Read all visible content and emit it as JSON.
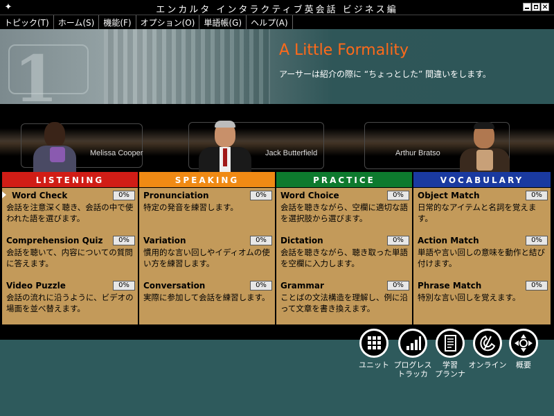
{
  "window": {
    "title": "エンカルタ インタラクティブ英会話 ビジネス編",
    "controls": [
      "minimize",
      "maximize",
      "close"
    ]
  },
  "menu": [
    "トピック(T)",
    "ホーム(S)",
    "機能(F)",
    "オプション(O)",
    "単語帳(G)",
    "ヘルプ(A)"
  ],
  "lesson": {
    "number": "1",
    "title": "A Little Formality",
    "description": "アーサーは紹介の際に “ちょっとした” 間違いをします。"
  },
  "characters": [
    {
      "name": "Melissa Cooper"
    },
    {
      "name": "Jack Butterfield"
    },
    {
      "name": "Arthur Bratso"
    }
  ],
  "colors": {
    "listening": "#d11d16",
    "speaking": "#f08a14",
    "practice": "#0d7a2e",
    "vocabulary": "#1a3aa0",
    "panel_bg": "#c39a5a",
    "title_orange": "#ff6a1a",
    "teal": "#2e5a5c"
  },
  "sections": [
    {
      "heading": "LISTENING",
      "activities": [
        {
          "title": "Word Check",
          "progress": "0%",
          "desc": "会話を注意深く聴き、会話の中で使われた語を選びます。",
          "selected": true
        },
        {
          "title": "Comprehension Quiz",
          "progress": "0%",
          "desc": "会話を聴いて、内容についての質問に答えます。"
        },
        {
          "title": "Video Puzzle",
          "progress": "0%",
          "desc": "会話の流れに沿うように、ビデオの場面を並べ替えます。"
        }
      ]
    },
    {
      "heading": "SPEAKING",
      "activities": [
        {
          "title": "Pronunciation",
          "progress": "0%",
          "desc": "特定の発音を練習します。"
        },
        {
          "title": "Variation",
          "progress": "0%",
          "desc": "慣用的な言い回しやイディオムの使い方を練習します。"
        },
        {
          "title": "Conversation",
          "progress": "0%",
          "desc": "実際に参加して会話を練習します。"
        }
      ]
    },
    {
      "heading": "PRACTICE",
      "activities": [
        {
          "title": "Word Choice",
          "progress": "0%",
          "desc": "会話を聴きながら、空欄に適切な語を選択肢から選びます。"
        },
        {
          "title": "Dictation",
          "progress": "0%",
          "desc": "会話を聴きながら、聴き取った単語を空欄に入力します。"
        },
        {
          "title": "Grammar",
          "progress": "0%",
          "desc": "ことばの文法構造を理解し、例に沿って文章を書き換えます。"
        }
      ]
    },
    {
      "heading": "VOCABULARY",
      "activities": [
        {
          "title": "Object Match",
          "progress": "0%",
          "desc": "日常的なアイテムと名詞を覚えます。"
        },
        {
          "title": "Action Match",
          "progress": "0%",
          "desc": "単語や言い回しの意味を動作と結び付けます。"
        },
        {
          "title": "Phrase Match",
          "progress": "0%",
          "desc": "特別な言い回しを覚えます。"
        }
      ]
    }
  ],
  "nav": [
    {
      "icon": "grid-icon",
      "label_line1": "ユニット",
      "label_line2": ""
    },
    {
      "icon": "bar-chart-icon",
      "label_line1": "プログレス",
      "label_line2": "トラッカ"
    },
    {
      "icon": "notebook-icon",
      "label_line1": "学習",
      "label_line2": "プランナ"
    },
    {
      "icon": "phone-icon",
      "label_line1": "オンライン",
      "label_line2": ""
    },
    {
      "icon": "compass-icon",
      "label_line1": "概要",
      "label_line2": ""
    }
  ]
}
